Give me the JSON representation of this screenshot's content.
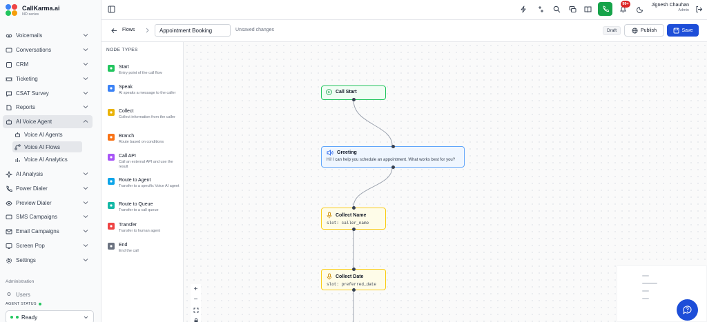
{
  "brand": {
    "name": "CallKarma.ai",
    "subtitle": "ND series"
  },
  "sidebar": {
    "items": [
      {
        "label": "Voicemails",
        "icon": "voicemail-icon"
      },
      {
        "label": "Conversations",
        "icon": "chat-icon"
      },
      {
        "label": "CRM",
        "icon": "crm-icon"
      },
      {
        "label": "Ticketing",
        "icon": "ticket-icon"
      },
      {
        "label": "CSAT Survey",
        "icon": "survey-icon"
      },
      {
        "label": "Reports",
        "icon": "reports-icon"
      },
      {
        "label": "AI Voice Agent",
        "icon": "bot-icon"
      },
      {
        "label": "AI Analysis",
        "icon": "sparkle-icon"
      },
      {
        "label": "Power Dialer",
        "icon": "phone-icon"
      },
      {
        "label": "Preview Dialer",
        "icon": "eye-icon"
      },
      {
        "label": "SMS Campaigns",
        "icon": "sms-icon"
      },
      {
        "label": "Email Campaigns",
        "icon": "mail-icon"
      },
      {
        "label": "Screen Pop",
        "icon": "screen-icon"
      },
      {
        "label": "Settings",
        "icon": "gear-icon"
      }
    ],
    "subitems": [
      {
        "label": "Voice AI Agents"
      },
      {
        "label": "Voice AI Flows"
      },
      {
        "label": "Voice AI Analytics"
      }
    ],
    "section_admin": "Administration",
    "admin_partial": "Users",
    "agent_status_label": "AGENT STATUS",
    "agent_status_value": "Ready"
  },
  "topbar": {
    "notification_count": "99+",
    "user_name": "Jignesh Chauhan",
    "user_role": "Admin"
  },
  "flowbar": {
    "breadcrumb": "Flows",
    "flow_name": "Appointment Booking",
    "unsaved": "Unsaved changes",
    "status": "Draft",
    "publish": "Publish",
    "save": "Save"
  },
  "palette": {
    "title": "NODE TYPES",
    "items": [
      {
        "name": "Start",
        "desc": "Entry point of the call flow",
        "color": "#22c55e"
      },
      {
        "name": "Speak",
        "desc": "AI speaks a message to the caller",
        "color": "#3b82f6"
      },
      {
        "name": "Collect",
        "desc": "Collect information from the caller",
        "color": "#eab308"
      },
      {
        "name": "Branch",
        "desc": "Route based on conditions",
        "color": "#f97316"
      },
      {
        "name": "Call API",
        "desc": "Call an external API and use the result",
        "color": "#a855f7"
      },
      {
        "name": "Route to Agent",
        "desc": "Transfer to a specific Voice AI agent",
        "color": "#0ea5e9"
      },
      {
        "name": "Route to Queue",
        "desc": "Transfer to a call queue",
        "color": "#14b8a6"
      },
      {
        "name": "Transfer",
        "desc": "Transfer to human agent",
        "color": "#ef4444"
      },
      {
        "name": "End",
        "desc": "End the call",
        "color": "#6b7280"
      }
    ]
  },
  "canvas": {
    "nodes": [
      {
        "title": "Call Start",
        "kind": "start"
      },
      {
        "title": "Greeting",
        "kind": "speak",
        "text": "Hi! I can help you schedule an appointment. What works best for you?"
      },
      {
        "title": "Collect Name",
        "kind": "collect",
        "slot": "slot: caller_name"
      },
      {
        "title": "Collect Date",
        "kind": "collect",
        "slot": "slot: preferred_date"
      }
    ],
    "zoom_in": "+",
    "zoom_out": "−"
  }
}
